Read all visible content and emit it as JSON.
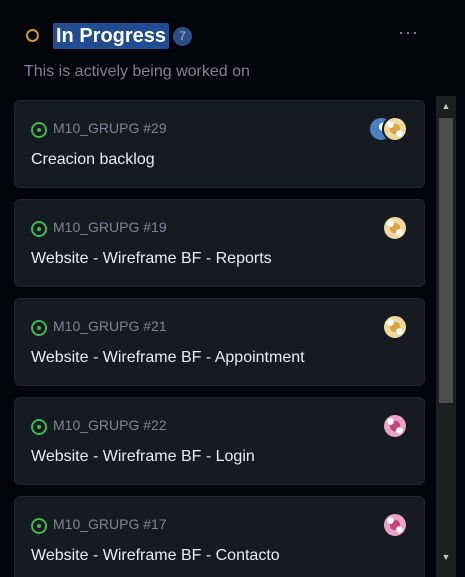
{
  "column": {
    "title": "In Progress",
    "count": "7",
    "description": "This is actively being worked on",
    "more_label": "···",
    "status_color": "#d29922"
  },
  "cards": [
    {
      "ref": "M10_GRUPG #29",
      "title": "Creacion backlog",
      "avatars": [
        "blue-avatar",
        "gold-avatar"
      ]
    },
    {
      "ref": "M10_GRUPG #19",
      "title": "Website - Wireframe BF - Reports",
      "avatars": [
        "gold-avatar"
      ]
    },
    {
      "ref": "M10_GRUPG #21",
      "title": "Website - Wireframe BF - Appointment",
      "avatars": [
        "gold-avatar"
      ]
    },
    {
      "ref": "M10_GRUPG #22",
      "title": "Website - Wireframe BF - Login",
      "avatars": [
        "pink-avatar"
      ]
    },
    {
      "ref": "M10_GRUPG #17",
      "title": "Website - Wireframe BF - Contacto",
      "avatars": [
        "pink-avatar"
      ]
    }
  ],
  "icons": {
    "status": "circle-status-icon",
    "issue": "issue-open-icon",
    "more": "more-options-icon",
    "scroll_up": "▲",
    "scroll_down": "▼"
  },
  "colors": {
    "issue_open": "#3fb950",
    "title_highlight": "#1f4d8f",
    "background": "#010409",
    "card": "#161b22"
  }
}
